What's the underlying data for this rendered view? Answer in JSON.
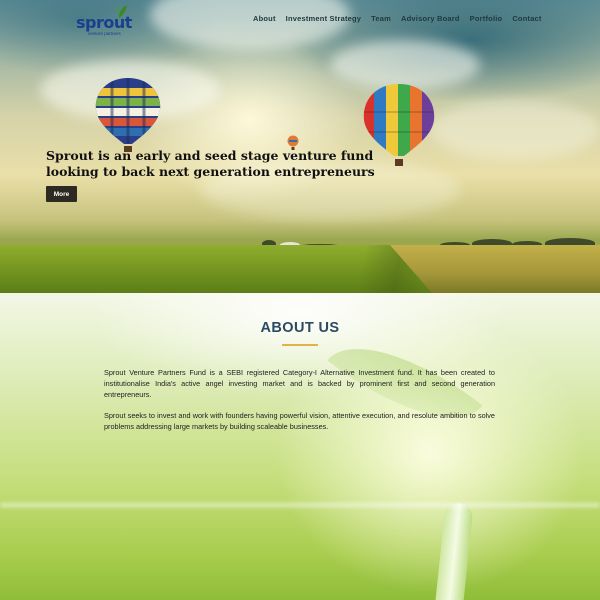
{
  "brand": {
    "name": "sprout",
    "tagline": "venture partners",
    "colors": {
      "primary": "#1a3f8f",
      "leaf": "#4a9a2e",
      "accent": "#e3b24c"
    }
  },
  "nav": {
    "items": [
      {
        "label": "About"
      },
      {
        "label": "Investment Strategy"
      },
      {
        "label": "Team"
      },
      {
        "label": "Advisory Board"
      },
      {
        "label": "Portfolio"
      },
      {
        "label": "Contact"
      }
    ]
  },
  "hero": {
    "headline": "Sprout is an early and seed stage venture fund looking to back next generation entrepreneurs",
    "cta_label": "More"
  },
  "about": {
    "title": "ABOUT US",
    "paragraphs": [
      "Sprout Venture Partners Fund is a SEBI registered Category-I Alternative Investment fund. It has been created to institutionalise India's active angel investing market and is backed by prominent first and second generation entrepreneurs.",
      "Sprout seeks to invest and work with founders having powerful vision, attentive execution, and resolute ambition to solve problems addressing large markets by building scaleable businesses."
    ]
  },
  "icons": [
    "leaf-icon",
    "hot-air-balloon-icon"
  ]
}
